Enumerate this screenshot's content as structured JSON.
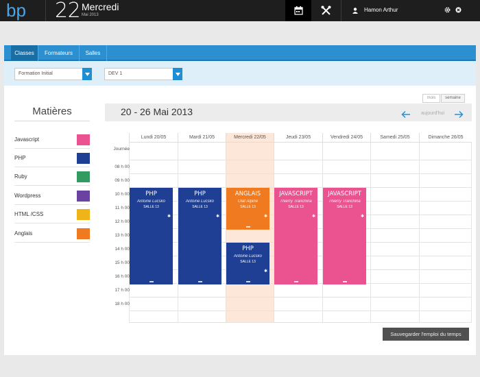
{
  "topbar": {
    "logo_text": "bp",
    "day_number": "22",
    "day_name": "Mercredi",
    "month_year": "Mai 2013",
    "user_name": "Hamon Arthur",
    "accent_color": "#4aa6e6"
  },
  "tabs": [
    {
      "label": "Classes",
      "active": true
    },
    {
      "label": "Formateurs",
      "active": false
    },
    {
      "label": "Salles",
      "active": false
    }
  ],
  "filters": {
    "formation": "Formation Initial",
    "classe": "DEV 1"
  },
  "view_toggle": {
    "mois": "mois",
    "semaine": "semaine"
  },
  "sidebar": {
    "title": "Matières",
    "items": [
      {
        "label": "Javascript",
        "color": "#ea5390"
      },
      {
        "label": "PHP",
        "color": "#1e3f94"
      },
      {
        "label": "Ruby",
        "color": "#339a62"
      },
      {
        "label": "Wordpress",
        "color": "#6a43a0"
      },
      {
        "label": "HTML /CSS",
        "color": "#efb417"
      },
      {
        "label": "Anglais",
        "color": "#f07a1f"
      }
    ]
  },
  "calendar": {
    "title": "20 - 26 Mai 2013",
    "today_label": "aujourd'hui",
    "days": [
      "Lundi 20/05",
      "Mardi 21/05",
      "Mercredi 22/05",
      "Jeudi 23/05",
      "Vendredi 24/05",
      "Samedi 25/05",
      "Dimanche 26/05"
    ],
    "rows": [
      "Journée",
      "08 h 00",
      "09 h 00",
      "10 h 00",
      "11 h 00",
      "12 h 00",
      "13 h 00",
      "14 h 00",
      "15 h 00",
      "16 h 00",
      "17 h 00",
      "18 h 00"
    ],
    "events": [
      {
        "title": "PHP",
        "person": "Antoine Lucsko",
        "room": "SALLE 13",
        "color": "#1e3f94"
      },
      {
        "title": "PHP",
        "person": "Antoine Lucsko",
        "room": "SALLE 13",
        "color": "#1e3f94"
      },
      {
        "title": "ANGLAIS",
        "person": "Olaf Alpine",
        "room": "SALLE 13",
        "color": "#f07a1f"
      },
      {
        "title": "PHP",
        "person": "Antoine Lucsko",
        "room": "SALLE 13",
        "color": "#1e3f94"
      },
      {
        "title": "JAVASCRIPT",
        "person": "Thierry Tranchina",
        "room": "SALLE 13",
        "color": "#ea5390"
      },
      {
        "title": "JAVASCRIPT",
        "person": "Thierry Tranchina",
        "room": "SALLE 13",
        "color": "#ea5390"
      }
    ]
  },
  "save_button": "Sauvegarder l'emploi du temps"
}
